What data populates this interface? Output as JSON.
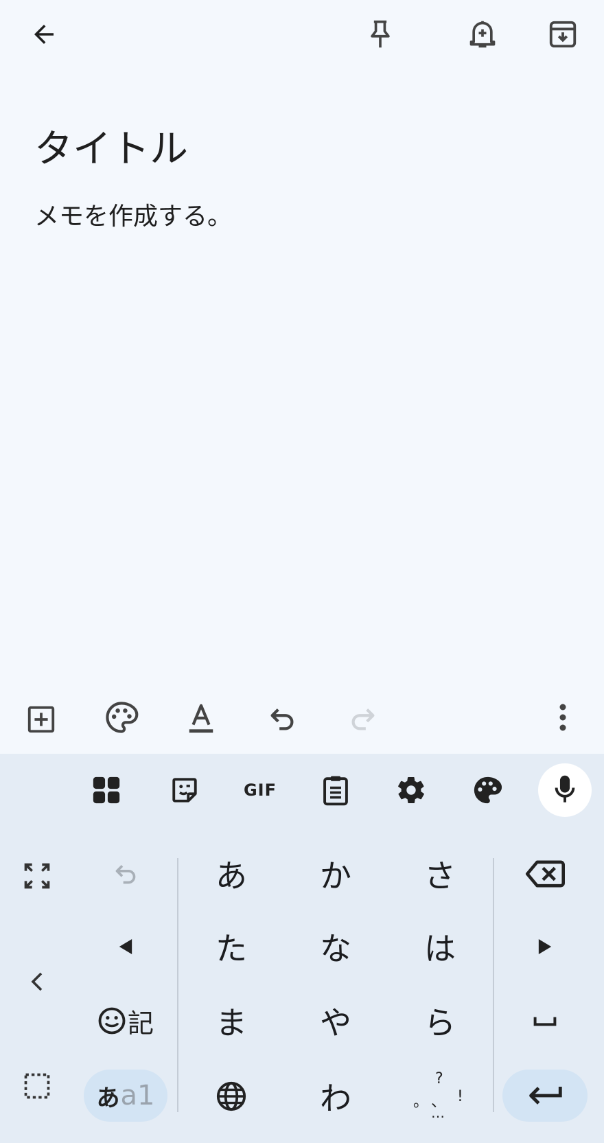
{
  "note": {
    "title": "タイトル",
    "body": "メモを作成する。"
  },
  "top_bar": {
    "icons": [
      "back-arrow-icon",
      "pin-icon",
      "add-reminder-icon",
      "archive-icon"
    ]
  },
  "editor_toolbar": {
    "icons": [
      "add-box-icon",
      "palette-icon",
      "text-format-icon",
      "undo-icon",
      "redo-icon",
      "more-vert-icon"
    ]
  },
  "keyboard": {
    "toolbar_icons": [
      "apps-grid-icon",
      "sticker-icon",
      "gif-icon",
      "clipboard-icon",
      "settings-icon",
      "theme-palette-icon",
      "mic-icon"
    ],
    "gif_label": "GIF",
    "kana_rows": [
      [
        "あ",
        "か",
        "さ"
      ],
      [
        "た",
        "な",
        "は"
      ],
      [
        "ま",
        "や",
        "ら"
      ],
      [
        "",
        "わ",
        ""
      ]
    ],
    "emoji_key_label": "記",
    "mode_key": {
      "hira": "あ",
      "latin": "a1"
    },
    "punct_key": {
      "top": "?",
      "left": "。",
      "mid": "、",
      "right": "!",
      "bottom": "…"
    },
    "colors": {
      "background": "#e4ecf5",
      "accent_key": "#d3e4f4",
      "mic_bg": "#ffffff"
    }
  }
}
